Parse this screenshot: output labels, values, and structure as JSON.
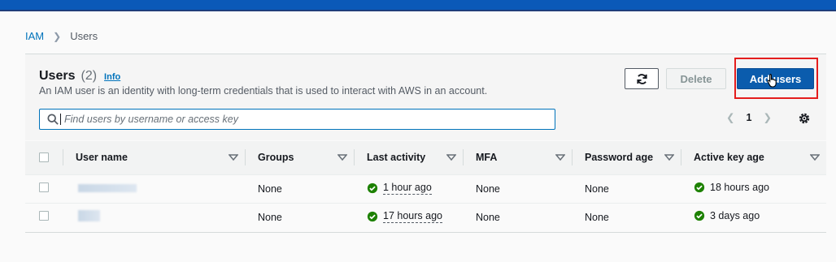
{
  "breadcrumb": {
    "root": "IAM",
    "current": "Users"
  },
  "header": {
    "title": "Users",
    "count": "(2)",
    "info": "Info",
    "description": "An IAM user is an identity with long-term credentials that is used to interact with AWS in an account."
  },
  "actions": {
    "delete": "Delete",
    "add_users": "Add users"
  },
  "search": {
    "placeholder": "Find users by username or access key"
  },
  "pagination": {
    "page": "1"
  },
  "table": {
    "columns": [
      "User name",
      "Groups",
      "Last activity",
      "MFA",
      "Password age",
      "Active key age"
    ],
    "rows": [
      {
        "user_name": "",
        "groups": "None",
        "last_activity": "1 hour ago",
        "mfa": "None",
        "password_age": "None",
        "active_key_age": "18 hours ago"
      },
      {
        "user_name": "",
        "groups": "None",
        "last_activity": "17 hours ago",
        "mfa": "None",
        "password_age": "None",
        "active_key_age": "3 days ago"
      }
    ]
  },
  "colors": {
    "accent": "#0073bb",
    "primary_button": "#0b5cad",
    "success": "#1d8102",
    "highlight": "#e41d1d",
    "topbar": "#0b59b8"
  }
}
